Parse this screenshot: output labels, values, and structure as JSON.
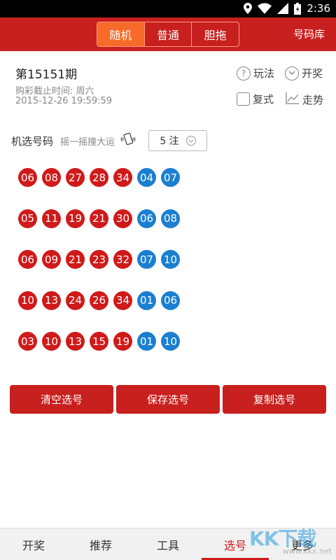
{
  "status_bar": {
    "time": "2:36"
  },
  "header": {
    "segments": [
      "随机",
      "普通",
      "胆拖"
    ],
    "active_segment": 0,
    "library_label": "号码库"
  },
  "issue": {
    "title": "第15151期",
    "deadline_label": "购彩截止时间: 周六",
    "datetime": "2015-12-26 19:59:59"
  },
  "options": {
    "rules": "玩法",
    "draw": "开奖",
    "compound": "复式",
    "trend": "走势"
  },
  "random_pick": {
    "title": "机选号码",
    "hint": "摇一摇撞大运",
    "count": "5 注"
  },
  "tickets": [
    {
      "red": [
        "06",
        "08",
        "27",
        "28",
        "34"
      ],
      "blue": [
        "04",
        "07"
      ]
    },
    {
      "red": [
        "05",
        "11",
        "19",
        "21",
        "30"
      ],
      "blue": [
        "06",
        "08"
      ]
    },
    {
      "red": [
        "06",
        "09",
        "21",
        "23",
        "32"
      ],
      "blue": [
        "07",
        "10"
      ]
    },
    {
      "red": [
        "10",
        "13",
        "24",
        "26",
        "34"
      ],
      "blue": [
        "01",
        "06"
      ]
    },
    {
      "red": [
        "03",
        "10",
        "13",
        "15",
        "19"
      ],
      "blue": [
        "01",
        "10"
      ]
    }
  ],
  "actions": {
    "clear": "清空选号",
    "save": "保存选号",
    "copy": "复制选号"
  },
  "tabs": [
    "开奖",
    "推荐",
    "工具",
    "选号",
    "更多"
  ],
  "active_tab": 3,
  "watermark": {
    "logo": "KK下载",
    "url": "www.kkx.net"
  },
  "colors": {
    "brand_red": "#c8201e",
    "ball_red": "#d01a1a",
    "ball_blue": "#1b7fd1",
    "segment_active": "#f76a2a"
  }
}
